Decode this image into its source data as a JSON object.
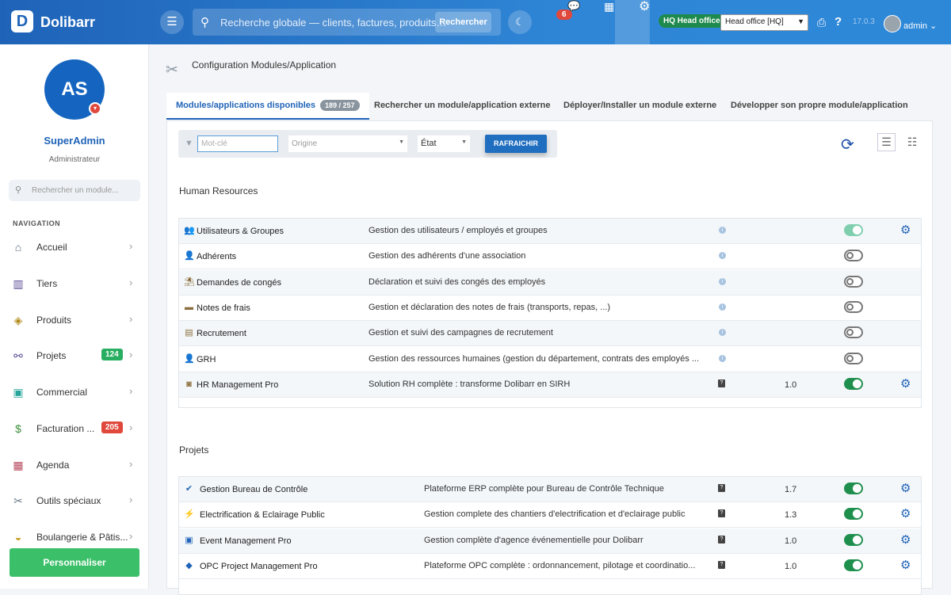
{
  "topbar": {
    "logo": "D",
    "brand": "Dolibarr",
    "search_placeholder": "Recherche globale — clients, factures, produits…",
    "search_button": "Rechercher",
    "messages_badge": "6",
    "entity_badge": "HQ Head office",
    "entity_select": "Head office [HQ]",
    "version": "17.0.3",
    "user": "admin"
  },
  "sidebar": {
    "avatar_initials": "AS",
    "user_name": "SuperAdmin",
    "user_role": "Administrateur",
    "search_placeholder": "Rechercher un module...",
    "nav_title": "NAVIGATION",
    "items": [
      {
        "label": "Accueil",
        "icon": "home-icon",
        "glyph": "⌂",
        "color": "#5a6b7d"
      },
      {
        "label": "Tiers",
        "icon": "building-icon",
        "glyph": "▥",
        "color": "#5c4d96"
      },
      {
        "label": "Produits",
        "icon": "box-icon",
        "glyph": "◈",
        "color": "#b38b1d"
      },
      {
        "label": "Projets",
        "icon": "sitemap-icon",
        "glyph": "⚯",
        "color": "#5c4d96",
        "count": "124",
        "count_color": "#27ae60"
      },
      {
        "label": "Commercial",
        "icon": "suitcase-icon",
        "glyph": "▣",
        "color": "#26a69a"
      },
      {
        "label": "Facturation ...",
        "icon": "invoice-icon",
        "glyph": "$",
        "color": "#3a8f3a",
        "count": "205",
        "count_color": "#e0483c"
      },
      {
        "label": "Agenda",
        "icon": "calendar-icon",
        "glyph": "▦",
        "color": "#b5485d"
      },
      {
        "label": "Outils spéciaux",
        "icon": "tools-icon",
        "glyph": "✂",
        "color": "#6b7a8a"
      },
      {
        "label": "Boulangerie & Pâtis...",
        "icon": "bread-icon",
        "glyph": "◒",
        "color": "#c8a02b"
      }
    ],
    "customize_button": "Personnaliser"
  },
  "breadcrumb": "Configuration Modules/Application",
  "tabs": [
    {
      "label": "Modules/applications disponibles",
      "count": "189 / 257"
    },
    {
      "label": "Rechercher un module/application externe"
    },
    {
      "label": "Déployer/Installer un module externe"
    },
    {
      "label": "Développer son propre module/application"
    }
  ],
  "filters": {
    "keyword_placeholder": "Mot-clé",
    "origin_placeholder": "Origine",
    "state_label": "État",
    "refresh_button": "RAFRAICHIR"
  },
  "sections": [
    {
      "title": "Human Resources",
      "modules": [
        {
          "name": "Utilisateurs & Groupes",
          "icon": "users-icon",
          "glyph": "👥",
          "desc": "Gestion des utilisateurs / employés et groupes",
          "info": "i",
          "version": "",
          "enabled": true,
          "light": true,
          "config": true
        },
        {
          "name": "Adhérents",
          "icon": "member-icon",
          "glyph": "👤",
          "desc": "Gestion des adhérents d'une association",
          "info": "i",
          "version": "",
          "enabled": false,
          "config": false
        },
        {
          "name": "Demandes de congés",
          "icon": "umbrella-beach-icon",
          "glyph": "⛱",
          "desc": "Déclaration et suivi des congés des employés",
          "info": "i",
          "version": "",
          "enabled": false,
          "config": false
        },
        {
          "name": "Notes de frais",
          "icon": "wallet-icon",
          "glyph": "▬",
          "desc": "Gestion et déclaration des notes de frais (transports, repas, ...)",
          "info": "i",
          "version": "",
          "enabled": false,
          "config": false
        },
        {
          "name": "Recrutement",
          "icon": "id-badge-icon",
          "glyph": "▤",
          "desc": "Gestion et suivi des campagnes de recrutement",
          "info": "i",
          "version": "",
          "enabled": false,
          "config": false
        },
        {
          "name": "GRH",
          "icon": "user-tie-icon",
          "glyph": "👤",
          "desc": "Gestion des ressources humaines (gestion du département, contrats des employés ...",
          "info": "i",
          "version": "",
          "enabled": false,
          "config": false
        },
        {
          "name": "HR Management Pro",
          "icon": "hr-pro-icon",
          "glyph": "◙",
          "desc": "Solution RH complète : transforme Dolibarr en SIRH",
          "info": "?",
          "version": "1.0",
          "enabled": true,
          "config": true
        }
      ]
    },
    {
      "title": "Projets",
      "modules": [
        {
          "name": "Gestion Bureau de Contrôle",
          "icon": "shield-check-icon",
          "glyph": "✔",
          "desc": "Plateforme ERP complète pour Bureau de Contrôle Technique",
          "info": "?",
          "version": "1.7",
          "enabled": true,
          "config": true
        },
        {
          "name": "Electrification & Eclairage Public",
          "icon": "lightning-icon",
          "glyph": "⚡",
          "desc": "Gestion complete des chantiers d'electrification et d'eclairage public",
          "info": "?",
          "version": "1.3",
          "enabled": true,
          "config": true
        },
        {
          "name": "Event Management Pro",
          "icon": "event-icon",
          "glyph": "▣",
          "desc": "Gestion complète d'agence événementielle pour Dolibarr",
          "info": "?",
          "version": "1.0",
          "enabled": true,
          "config": true
        },
        {
          "name": "OPC Project Management Pro",
          "icon": "opc-icon",
          "glyph": "◆",
          "desc": "Plateforme OPC complète : ordonnancement, pilotage et coordinatio...",
          "info": "?",
          "version": "1.0",
          "enabled": true,
          "config": true
        }
      ]
    }
  ]
}
